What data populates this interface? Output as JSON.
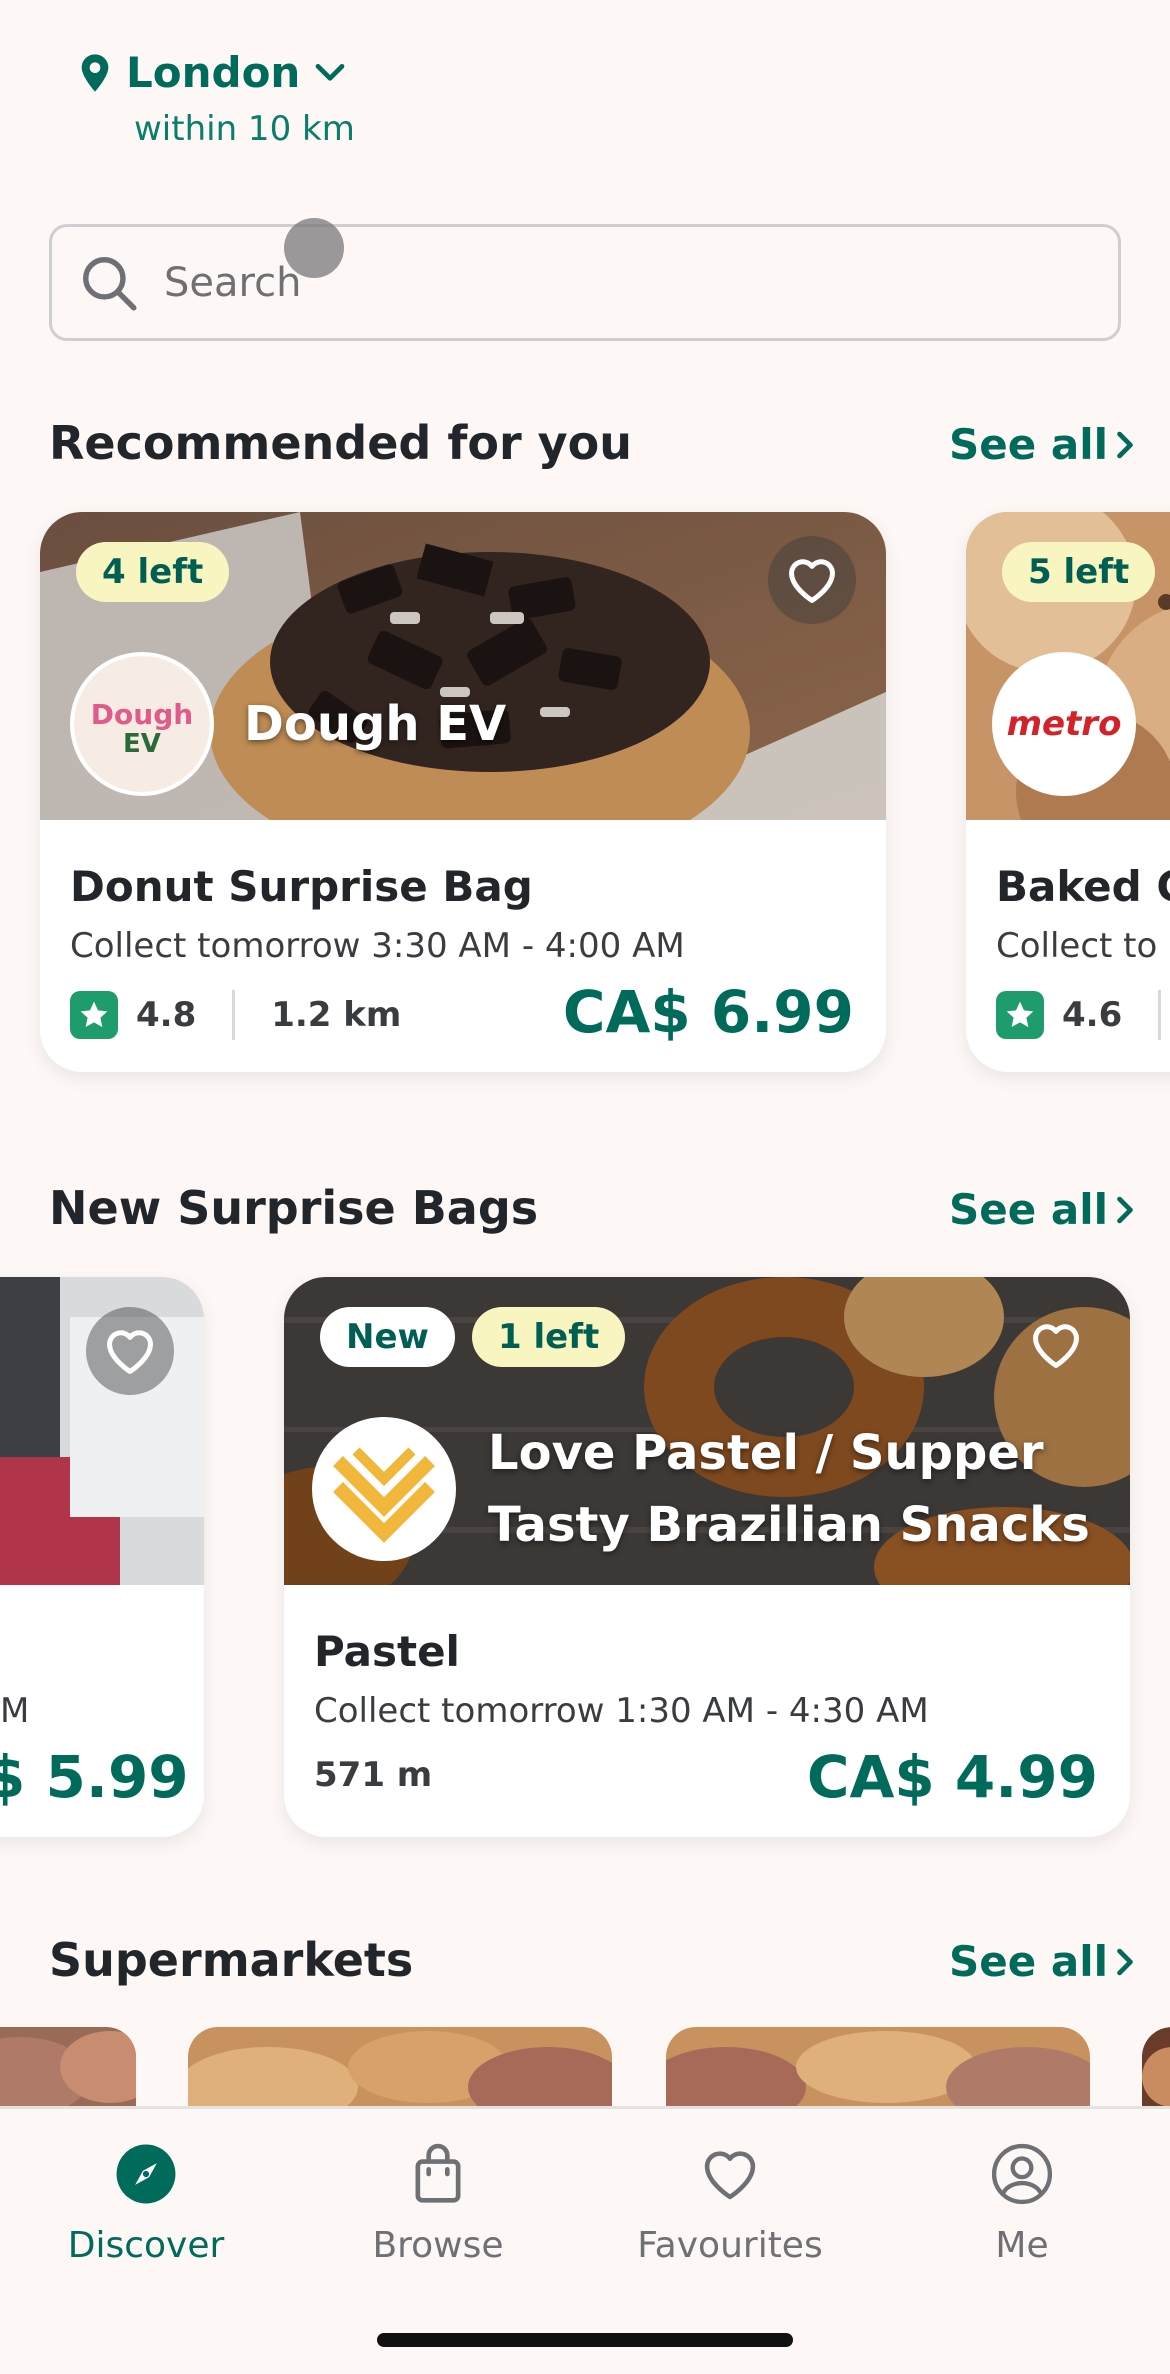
{
  "location": {
    "city": "London",
    "radius": "within 10 km"
  },
  "search": {
    "placeholder": "Search"
  },
  "sections": {
    "recommended": {
      "title": "Recommended for you",
      "see_all": "See all"
    },
    "new_bags": {
      "title": "New Surprise Bags",
      "see_all": "See all"
    },
    "supermarkets": {
      "title": "Supermarkets",
      "see_all": "See all"
    }
  },
  "recommended_cards": [
    {
      "badge": "4 left",
      "store": "Dough EV",
      "logo_text": "Dough EV",
      "item": "Donut Surprise Bag",
      "collect": "Collect tomorrow 3:30 AM - 4:00 AM",
      "rating": "4.8",
      "distance": "1.2 km",
      "price": "CA$ 6.99"
    },
    {
      "badge": "5 left",
      "store": "",
      "logo_text": "metro",
      "item": "Baked G",
      "collect": "Collect to",
      "rating": "4.6",
      "distance": "",
      "price": ""
    }
  ],
  "new_cards": [
    {
      "partial_collect": "M",
      "price": "$ 5.99"
    },
    {
      "badge_new": "New",
      "badge": "1 left",
      "store_line1": "Love Pastel / Supper",
      "store_line2": "Tasty Brazilian Snacks",
      "item": "Pastel",
      "collect": "Collect tomorrow 1:30 AM - 4:30 AM",
      "distance": "571 m",
      "price": "CA$ 4.99"
    }
  ],
  "tabs": [
    {
      "label": "Discover",
      "icon": "compass-icon",
      "active": true
    },
    {
      "label": "Browse",
      "icon": "shopping-bag-icon",
      "active": false
    },
    {
      "label": "Favourites",
      "icon": "heart-icon",
      "active": false
    },
    {
      "label": "Me",
      "icon": "user-circle-icon",
      "active": false
    }
  ],
  "colors": {
    "brand": "#006a5b",
    "badge": "#f8f5c0",
    "star": "#1f9c6c",
    "background": "#fdf8f6"
  }
}
